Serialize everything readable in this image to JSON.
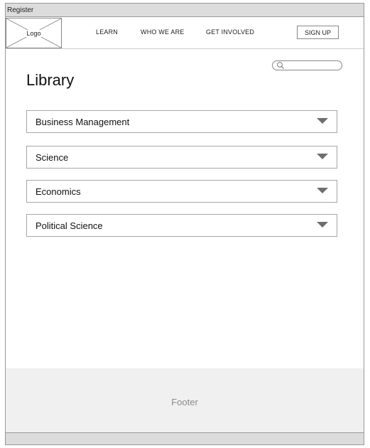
{
  "window": {
    "title": "Register"
  },
  "header": {
    "logo_label": "Logo",
    "nav": [
      {
        "label": "LEARN"
      },
      {
        "label": "WHO WE ARE"
      },
      {
        "label": "GET INVOLVED"
      }
    ],
    "signup_label": "SIGN UP"
  },
  "search": {
    "placeholder": "",
    "value": "",
    "icon": "search-icon"
  },
  "main": {
    "title": "Library",
    "sections": [
      {
        "label": "Business Management",
        "icon": "chevron-down-icon"
      },
      {
        "label": "Science",
        "icon": "chevron-down-icon"
      },
      {
        "label": "Economics",
        "icon": "chevron-down-icon"
      },
      {
        "label": "Political Science",
        "icon": "chevron-down-icon"
      }
    ]
  },
  "footer": {
    "label": "Footer"
  },
  "colors": {
    "chrome": "#dcdcdc",
    "border": "#888888",
    "chevron": "#6e6e6e",
    "footer_bg": "#f0f0f0",
    "footer_text": "#8a8a8a"
  }
}
